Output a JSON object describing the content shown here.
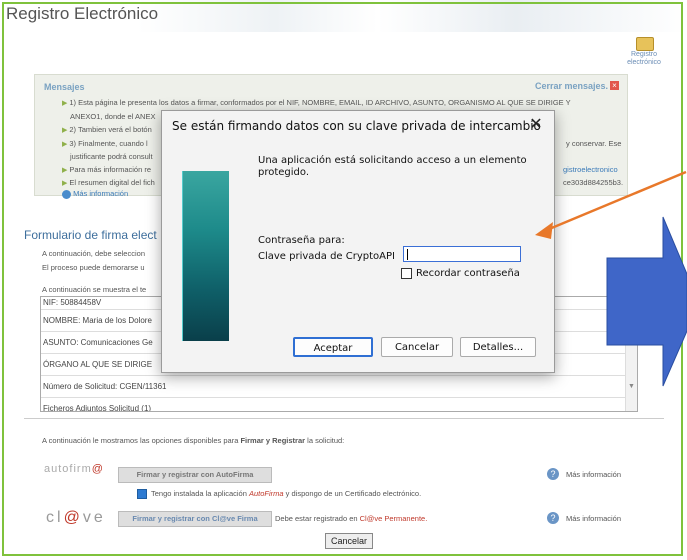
{
  "page": {
    "title": "Registro Electrónico"
  },
  "register_icon_label": "Registro electrónico",
  "messages": {
    "heading": "Mensajes",
    "close_label": "Cerrar mensajes.",
    "lines": [
      "1) Esta página le presenta los datos a firmar, conformados por el NIF, NOMBRE, EMAIL, ID ARCHIVO, ASUNTO, ORGANISMO AL QUE SE DIRIGE Y",
      "ANEXO1, donde el ANEX",
      "2) Tambien verá el botón",
      "3) Finalmente, cuando l",
      "justificante podrá consult",
      "Para más información re",
      "El resumen digital del fich"
    ],
    "right_fragments": [
      "y conservar. Ese",
      "gistroelectronico",
      "ce303d884255b3."
    ],
    "more_info": "Más información"
  },
  "form": {
    "title": "Formulario de firma elect",
    "line1": "A continuación, debe seleccion",
    "line2": "El proceso puede demorarse u",
    "line3": "A continuación se muestra el te",
    "textarea_lines": [
      "NIF: 50884458V",
      "NOMBRE: Maria de los Dolore",
      "ASUNTO: Comunicaciones Ge",
      "ÓRGANO AL QUE SE DIRIGE",
      "Número de Solicitud: CGEN/11361",
      "Ficheros Adjuntos Solicitud (1)"
    ]
  },
  "options": {
    "intro_prefix": "A continuación le mostramos las opciones disponibles para ",
    "intro_bold1": "Firmar y Registrar",
    "intro_suffix": " la solicitud:",
    "autofirma_logo_a": "autofirm",
    "autofirma_logo_b": "@",
    "autofirma_button": "Firmar y registrar con AutoFirma",
    "checkbox_prefix": "Tengo instalada la aplicación ",
    "checkbox_app": "AutoFirma",
    "checkbox_suffix": " y dispongo de un Certificado electrónico.",
    "clave_logo_a": "cl",
    "clave_logo_b": "@",
    "clave_logo_c": "ve",
    "clave_button": "Firmar y registrar con Cl@ve Firma",
    "clave_note_prefix": "Debe estar registrado en ",
    "clave_note_link": "Cl@ve Permanente.",
    "more_info": "Más información",
    "cancel": "Cancelar"
  },
  "dialog": {
    "title": "Se están firmando datos con su clave privada de intercambio",
    "message": "Una aplicación está solicitando acceso a un elemento protegido.",
    "password_for": "Contraseña para:",
    "key_name": "Clave privada de CryptoAPI",
    "password_value": "",
    "remember": "Recordar contraseña",
    "accept": "Aceptar",
    "cancel": "Cancelar",
    "details": "Detalles..."
  },
  "colors": {
    "accent": "#2f6fd3",
    "annotation_orange": "#e8782a",
    "annotation_blue": "#3f66c8"
  }
}
